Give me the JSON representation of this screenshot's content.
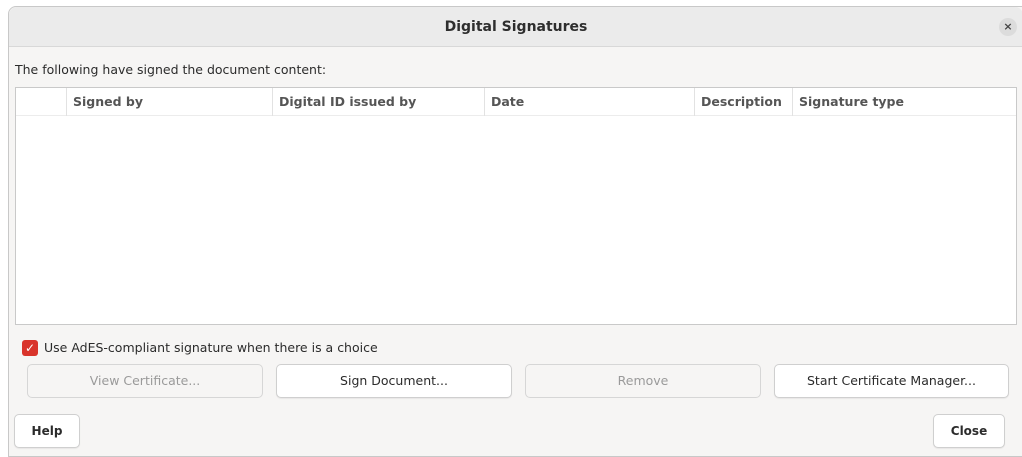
{
  "window": {
    "title": "Digital Signatures",
    "close_glyph": "×"
  },
  "intro_text": "The following have signed the document content:",
  "table": {
    "columns": [
      "",
      "Signed by",
      "Digital ID issued by",
      "Date",
      "Description",
      "Signature type"
    ],
    "rows": []
  },
  "ades_checkbox": {
    "label": "Use AdES-compliant signature when there is a choice",
    "checked": true,
    "check_glyph": "✓",
    "color": "#d9342b"
  },
  "buttons": {
    "view_certificate": "View Certificate...",
    "sign_document": "Sign Document...",
    "remove": "Remove",
    "start_certificate_manager": "Start Certificate Manager...",
    "help": "Help",
    "close": "Close"
  }
}
